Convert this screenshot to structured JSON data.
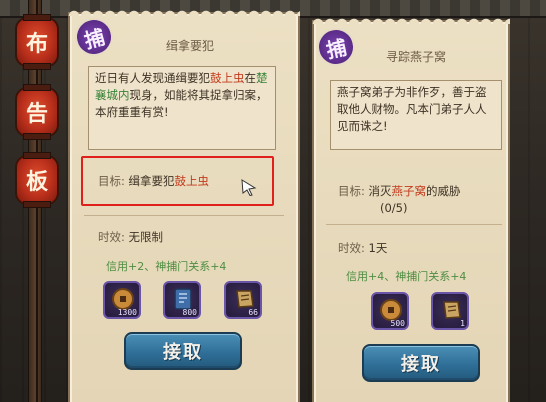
{
  "side_sign": {
    "chars": [
      "布",
      "告",
      "板"
    ]
  },
  "quests": [
    {
      "emblem": "捕",
      "title": "缉拿要犯",
      "desc": {
        "p1": "近日有人发现通缉要犯",
        "name": "鼓上虫",
        "p2": "在",
        "place": "楚襄城内",
        "p3": "现身，如能将其捉拿归案，本府重重有赏!"
      },
      "target_label": "目标:",
      "target_text": "缉拿要犯",
      "target_name": "鼓上虫",
      "time_label": "时效:",
      "time_value": "无限制",
      "reward": "信用+2、神捕门关系+4",
      "items": [
        {
          "icon": "coin-icon",
          "qty": "1300"
        },
        {
          "icon": "blue-book-icon",
          "qty": "800"
        },
        {
          "icon": "scroll-icon",
          "qty": "66"
        }
      ],
      "button": "接取"
    },
    {
      "emblem": "捕",
      "title": "寻踪燕子窝",
      "desc": {
        "p1": "燕子窝弟子为非作歹，善于盗取他人财物。凡本门弟子人人见而诛之!"
      },
      "target_label": "目标:",
      "target_text_pre": "消灭",
      "target_name": "燕子窝",
      "target_text_post": "的威胁",
      "progress": "(0/5)",
      "time_label": "时效:",
      "time_value": "1天",
      "reward": "信用+4、神捕门关系+4",
      "items": [
        {
          "icon": "coin-icon",
          "qty": "500"
        },
        {
          "icon": "scroll-icon",
          "qty": "1"
        }
      ],
      "button": "接取"
    }
  ],
  "colors": {
    "highlight_red": "#c13a1c",
    "reward_green": "#4e8d42",
    "button_blue": "#2f6f98",
    "selection_red": "#e0201b"
  }
}
